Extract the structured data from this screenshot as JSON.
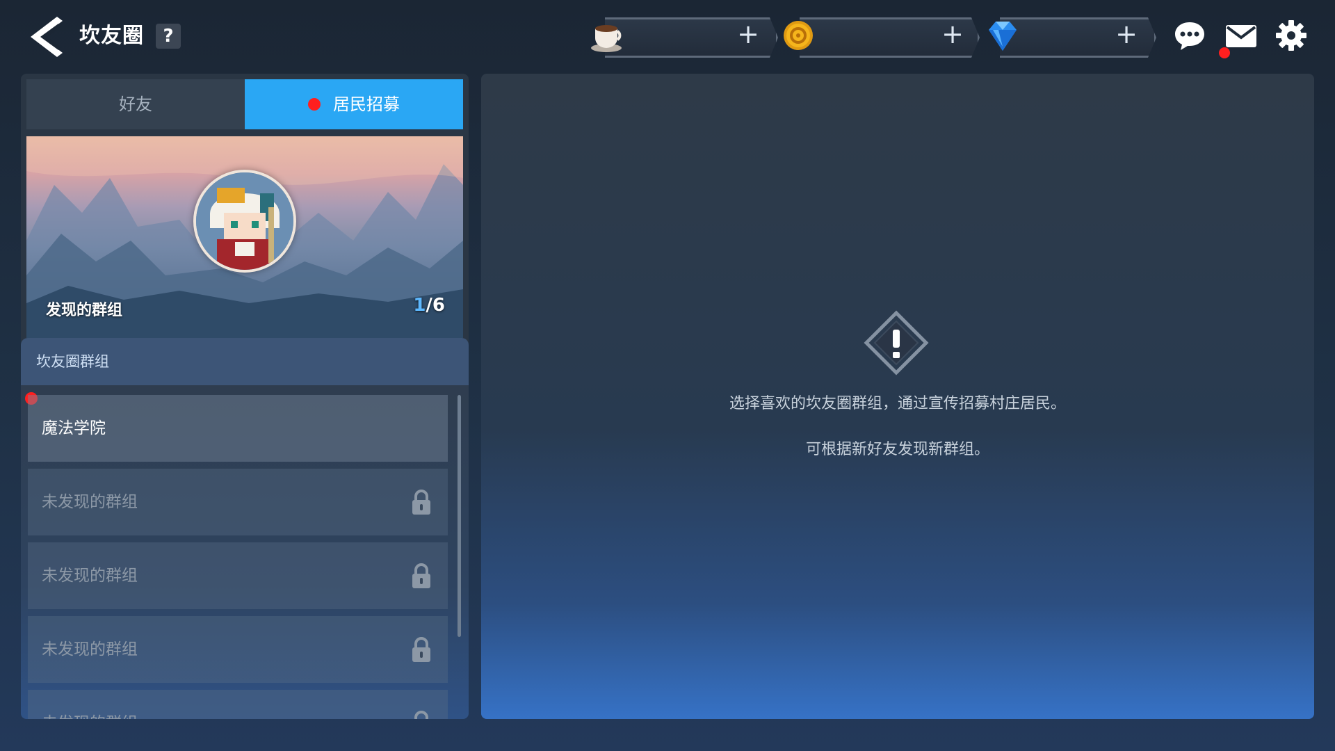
{
  "header": {
    "title": "坎友圈",
    "help_label": "?"
  },
  "currencies": [
    {
      "icon": "coffee-cup-icon",
      "value": "",
      "plus": "+"
    },
    {
      "icon": "gold-coin-icon",
      "value": "",
      "plus": "+"
    },
    {
      "icon": "blue-gem-icon",
      "value": "",
      "plus": "+"
    }
  ],
  "top_icons": [
    "chat-bubble-icon",
    "mail-icon",
    "gear-icon"
  ],
  "tabs": {
    "friends": "好友",
    "recruit": "居民招募"
  },
  "banner": {
    "label": "发现的群组",
    "count_current": "1",
    "count_total": "/6"
  },
  "group_section": {
    "title": "坎友圈群组",
    "items": [
      {
        "label": "魔法学院"
      },
      {
        "label": "未发现的群组"
      },
      {
        "label": "未发现的群组"
      },
      {
        "label": "未发现的群组"
      },
      {
        "label": "未发现的群组"
      }
    ]
  },
  "notice": {
    "line1": "选择喜欢的坎友圈群组，通过宣传招募村庄居民。",
    "line2": "可根据新好友发现新群组。"
  },
  "colors": {
    "accent_tab": "#2aa7f4",
    "notification_dot": "#ff1f1f",
    "count_highlight": "#5db8ff"
  }
}
